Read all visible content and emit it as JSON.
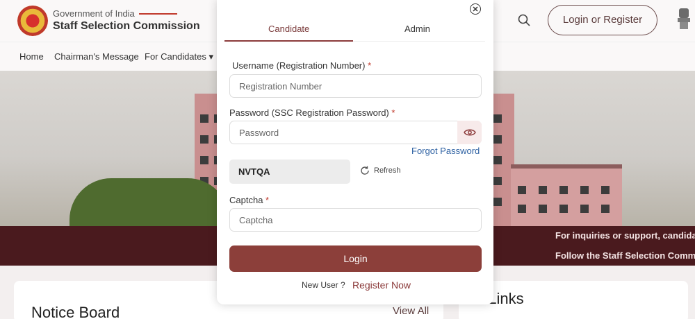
{
  "header": {
    "gov_line": "Government of India",
    "org_name": "Staff Selection Commission",
    "login_register_label": "Login or Register"
  },
  "nav": {
    "items": [
      "Home",
      "Chairman's Message",
      "For Candidates ▾"
    ]
  },
  "ticker": {
    "line1": "For inquiries or support, candidat",
    "line2": "Follow the Staff Selection Comm"
  },
  "sections": {
    "notice_board_title": "Notice Board",
    "view_all_label": "View All",
    "quick_links_title": "t Links"
  },
  "modal": {
    "tabs": [
      {
        "label": "Candidate",
        "active": true
      },
      {
        "label": "Admin",
        "active": false
      }
    ],
    "username": {
      "label": "Username (Registration Number)",
      "required_mark": "*",
      "placeholder": "Registration Number",
      "value": ""
    },
    "password": {
      "label": "Password (SSC Registration Password)",
      "required_mark": "*",
      "placeholder": "Password",
      "value": ""
    },
    "forgot_password_label": "Forgot Password",
    "captcha_code": "NVTQA",
    "refresh_label": "Refresh",
    "captcha": {
      "label": "Captcha",
      "required_mark": "*",
      "placeholder": "Captcha",
      "value": ""
    },
    "login_label": "Login",
    "new_user_label": "New User ?",
    "register_now_label": "Register Now"
  },
  "colors": {
    "accent": "#8c3f3a",
    "ticker_bg": "#4a1a1e",
    "link_blue": "#2f62a3",
    "required": "#c0392b"
  },
  "icons": [
    "search-icon",
    "emblem-icon",
    "close-icon",
    "eye-icon",
    "refresh-icon",
    "ssc-logo-icon"
  ]
}
